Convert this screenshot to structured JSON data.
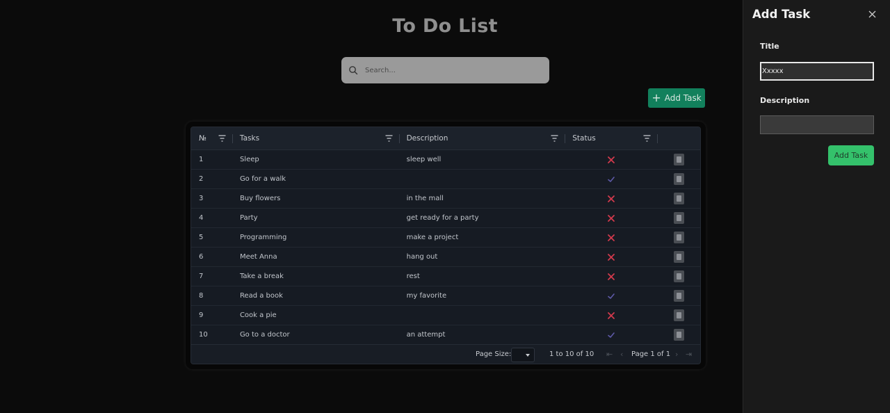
{
  "app": {
    "title": "To Do List",
    "search": {
      "placeholder": "Search..."
    },
    "add_button_label": "Add Task"
  },
  "table": {
    "columns": [
      "№",
      "Tasks",
      "Description",
      "Status"
    ],
    "rows": [
      {
        "num": "1",
        "task": "Sleep",
        "description": "sleep well",
        "status": "incomplete"
      },
      {
        "num": "2",
        "task": "Go for a walk",
        "description": "",
        "status": "complete"
      },
      {
        "num": "3",
        "task": "Buy flowers",
        "description": "in the mall",
        "status": "incomplete"
      },
      {
        "num": "4",
        "task": "Party",
        "description": "get ready for a party",
        "status": "incomplete"
      },
      {
        "num": "5",
        "task": "Programming",
        "description": "make a project",
        "status": "incomplete"
      },
      {
        "num": "6",
        "task": "Meet Anna",
        "description": "hang out",
        "status": "incomplete"
      },
      {
        "num": "7",
        "task": "Take a break",
        "description": "rest",
        "status": "incomplete"
      },
      {
        "num": "8",
        "task": "Read a book",
        "description": "my favorite",
        "status": "complete"
      },
      {
        "num": "9",
        "task": "Cook a pie",
        "description": "",
        "status": "incomplete"
      },
      {
        "num": "10",
        "task": "Go to a doctor",
        "description": "an attempt",
        "status": "complete"
      }
    ],
    "footer": {
      "page_size_label": "Page Size:",
      "range": "1 to 10 of 10",
      "page_info": "Page 1 of 1"
    }
  },
  "drawer": {
    "title": "Add Task",
    "title_label": "Title",
    "title_value": "Xxxxx",
    "description_label": "Description",
    "description_value": "",
    "submit_label": "Add Task"
  },
  "colors": {
    "accent_green": "#12805c",
    "submit_green": "#34c16b",
    "cross_red": "#d33a4d",
    "check_purple": "#5e5aa8"
  }
}
